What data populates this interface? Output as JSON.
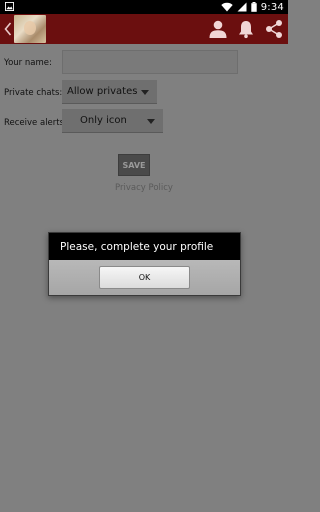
{
  "status_bar": {
    "time": "9:34",
    "icons": [
      "photo-icon",
      "wifi-icon",
      "signal-icon",
      "battery-icon"
    ]
  },
  "action_bar": {
    "color": "#6b0f0f",
    "icons": [
      "back-chevron-icon",
      "profile-icon",
      "bell-icon",
      "share-icon"
    ]
  },
  "form": {
    "name_label": "Your name:",
    "name_value": "",
    "private_label": "Private chats:",
    "private_value": "Allow privates",
    "alerts_label": "Receive alerts:",
    "alerts_value": "Only icon",
    "save_label": "SAVE",
    "privacy_link": "Privacy Policy"
  },
  "dialog": {
    "message": "Please, complete your profile",
    "ok_label": "OK"
  }
}
